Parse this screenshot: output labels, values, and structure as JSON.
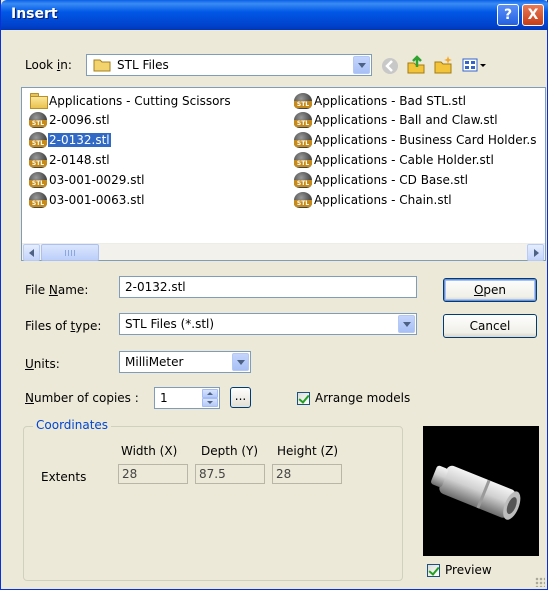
{
  "window": {
    "title": "Insert",
    "help_label": "?",
    "close_label": "X"
  },
  "look_in": {
    "label_prefix": "Look ",
    "label_access_key": "i",
    "label_suffix": "n:",
    "value": "STL Files",
    "icons": [
      "back-icon",
      "up-folder-icon",
      "new-folder-icon",
      "view-menu-icon"
    ]
  },
  "file_list": {
    "items": [
      {
        "name": "Applications - Cutting Scissors",
        "type": "folder",
        "selected": false
      },
      {
        "name": "2-0096.stl",
        "type": "stl",
        "selected": false
      },
      {
        "name": "2-0132.stl",
        "type": "stl",
        "selected": true
      },
      {
        "name": "2-0148.stl",
        "type": "stl",
        "selected": false
      },
      {
        "name": "03-001-0029.stl",
        "type": "stl",
        "selected": false
      },
      {
        "name": "03-001-0063.stl",
        "type": "stl",
        "selected": false
      },
      {
        "name": "Applications - Bad STL.stl",
        "type": "stl",
        "selected": false
      },
      {
        "name": "Applications - Ball and Claw.stl",
        "type": "stl",
        "selected": false
      },
      {
        "name": "Applications - Business Card Holder.s",
        "type": "stl",
        "selected": false
      },
      {
        "name": "Applications - Cable Holder.stl",
        "type": "stl",
        "selected": false
      },
      {
        "name": "Applications - CD Base.stl",
        "type": "stl",
        "selected": false
      },
      {
        "name": "Applications - Chain.stl",
        "type": "stl",
        "selected": false
      }
    ]
  },
  "file_name": {
    "label_access_key": "N",
    "label_prefix": "File ",
    "label_suffix": "ame:",
    "value": "2-0132.stl"
  },
  "files_of_type": {
    "label_prefix": "Files of ",
    "label_access_key": "t",
    "label_suffix": "ype:",
    "value": "STL Files (*.stl)"
  },
  "buttons": {
    "open_access_key": "O",
    "open_rest": "pen",
    "cancel": "Cancel",
    "dots": "..."
  },
  "units": {
    "label_access_key": "U",
    "label_suffix": "nits:",
    "value": "MilliMeter"
  },
  "copies": {
    "label_access_key": "N",
    "label_suffix": "umber of copies :",
    "value": "1"
  },
  "arrange": {
    "label": "Arrange models",
    "checked": true
  },
  "coordinates": {
    "title": "Coordinates",
    "headers": [
      "Width (X)",
      "Depth (Y)",
      "Height (Z)"
    ],
    "row_label": "Extents",
    "values": [
      "28",
      "87.5",
      "28"
    ]
  },
  "preview": {
    "label": "Preview",
    "checked": true
  }
}
